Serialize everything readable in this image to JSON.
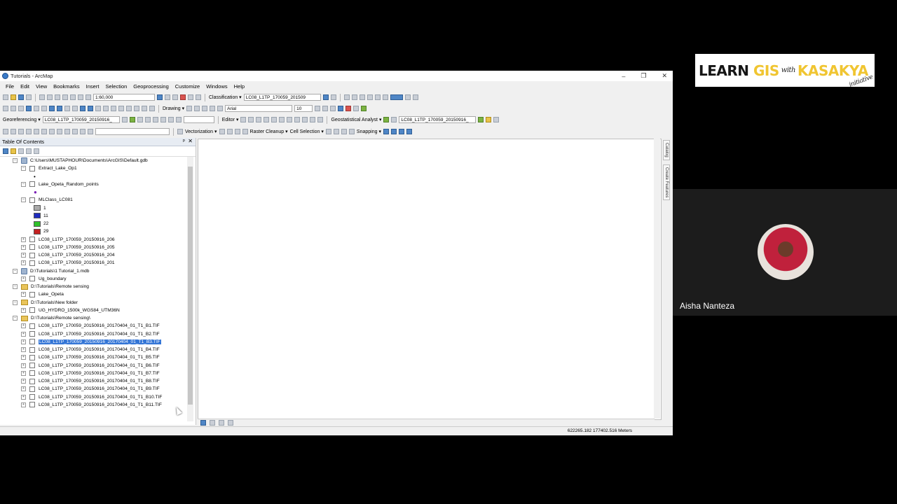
{
  "window": {
    "title": "Tutorials - ArcMap",
    "minimize": "–",
    "maximize": "❐",
    "close": "✕"
  },
  "menu": [
    "File",
    "Edit",
    "View",
    "Bookmarks",
    "Insert",
    "Selection",
    "Geoprocessing",
    "Customize",
    "Windows",
    "Help"
  ],
  "toolbar": {
    "scale": "1:60,000",
    "classification_label": "Classification ▾",
    "classification_layer": "LC08_L1TP_170059_201509",
    "drawing_label": "Drawing ▾",
    "font_name": "Arial",
    "font_size": "10",
    "georeferencing_label": "Georeferencing ▾",
    "georef_layer": "LC08_L1TP_170059_20150916_",
    "editor_label": "Editor ▾",
    "geostat_label": "Geostatistical Analyst ▾",
    "geostat_layer": "LC08_L1TP_170059_20150916_",
    "vectorization_label": "Vectorization ▾",
    "raster_cleanup_label": "Raster Cleanup ▾",
    "cell_selection_label": "Cell Selection ▾",
    "snapping_label": "Snapping ▾"
  },
  "toc": {
    "title": "Table Of Contents",
    "pin": "ᵖ",
    "close": "✕",
    "rows": [
      {
        "type": "db",
        "expand": "–",
        "text": "C:\\Users\\MUSTAPHOUR\\Documents\\ArcGIS\\Default.gdb"
      },
      {
        "type": "layer",
        "expand": "–",
        "text": "Extract_Lake_Op1"
      },
      {
        "type": "sym",
        "text": "•"
      },
      {
        "type": "layer",
        "expand": "–",
        "text": "Lake_Opeta_Random_points"
      },
      {
        "type": "sym",
        "text": "●"
      },
      {
        "type": "layer",
        "expand": "–",
        "text": "MLClass_LC081"
      },
      {
        "type": "class",
        "text": "1",
        "color": "#a9a9a9"
      },
      {
        "type": "class",
        "text": "11",
        "color": "#1f2cbf"
      },
      {
        "type": "class",
        "text": "22",
        "color": "#2fc12a"
      },
      {
        "type": "class",
        "text": "29",
        "color": "#c42121"
      },
      {
        "type": "layer",
        "expand": "+",
        "text": "LC08_L1TP_170059_20150916_206"
      },
      {
        "type": "layer",
        "expand": "+",
        "text": "LC08_L1TP_170059_20150916_205"
      },
      {
        "type": "layer",
        "expand": "+",
        "text": "LC08_L1TP_170059_20150916_204"
      },
      {
        "type": "layer",
        "expand": "+",
        "text": "LC08_L1TP_170059_20150916_201"
      },
      {
        "type": "db",
        "expand": "–",
        "text": "D:\\Tutorials\\1 Tutorial_1.mdb"
      },
      {
        "type": "layer",
        "expand": "+",
        "text": "Ug_boundary"
      },
      {
        "type": "folder",
        "expand": "–",
        "text": "D:\\Tutorials\\Remote sensing"
      },
      {
        "type": "layer",
        "expand": "+",
        "text": "Lake_Opeta"
      },
      {
        "type": "folder",
        "expand": "–",
        "text": "D:\\Tutorials\\New folder"
      },
      {
        "type": "layer",
        "expand": "+",
        "text": "UG_HYDRO_1500k_WGS84_UTM36N"
      },
      {
        "type": "folder",
        "expand": "–",
        "text": "D:\\Tutorials\\Remote sensing\\"
      },
      {
        "type": "layer",
        "expand": "+",
        "text": "LC08_L1TP_170059_20150916_20170404_01_T1_B1.TIF"
      },
      {
        "type": "layer",
        "expand": "+",
        "text": "LC08_L1TP_170059_20150916_20170404_01_T1_B2.TIF"
      },
      {
        "type": "layer",
        "expand": "+",
        "text": "LC08_L1TP_170059_20150916_20170404_01_T1_B3.TIF",
        "selected": true
      },
      {
        "type": "layer",
        "expand": "+",
        "text": "LC08_L1TP_170059_20150916_20170404_01_T1_B4.TIF"
      },
      {
        "type": "layer",
        "expand": "+",
        "text": "LC08_L1TP_170059_20150916_20170404_01_T1_B5.TIF"
      },
      {
        "type": "layer",
        "expand": "+",
        "text": "LC08_L1TP_170059_20150916_20170404_01_T1_B6.TIF"
      },
      {
        "type": "layer",
        "expand": "+",
        "text": "LC08_L1TP_170059_20150916_20170404_01_T1_B7.TIF"
      },
      {
        "type": "layer",
        "expand": "+",
        "text": "LC08_L1TP_170059_20150916_20170404_01_T1_B8.TIF"
      },
      {
        "type": "layer",
        "expand": "+",
        "text": "LC08_L1TP_170059_20150916_20170404_01_T1_B9.TIF"
      },
      {
        "type": "layer",
        "expand": "+",
        "text": "LC08_L1TP_170059_20150916_20170404_01_T1_B10.TIF"
      },
      {
        "type": "layer",
        "expand": "+",
        "text": "LC08_L1TP_170059_20150916_20170404_01_T1_B11.TIF"
      }
    ]
  },
  "side_tabs": [
    "Catalog",
    "Create Features"
  ],
  "status": {
    "coordinates": "622265.182  177402.516 Meters"
  },
  "logo": {
    "learn": "LEARN",
    "gis": "GIS",
    "with": "with",
    "kasakya": "KASAKYA",
    "initiative": "initiative"
  },
  "participant": {
    "name": "Aisha Nanteza"
  },
  "colors": {
    "selection": "#3375d6",
    "logo_yellow": "#f0c531"
  }
}
